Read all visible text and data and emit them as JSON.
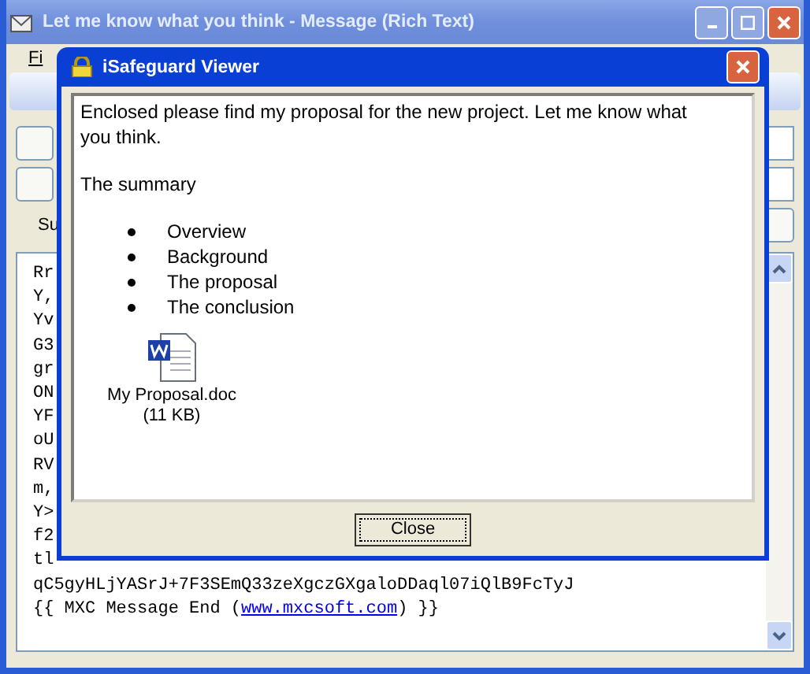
{
  "window": {
    "title": "Let me know what you think - Message (Rich Text)"
  },
  "menu": {
    "item": "Fi"
  },
  "subject_label": "Su",
  "body": {
    "hidden_lines": [
      "Rr",
      "Y,",
      "Yv",
      "G3",
      "gr",
      "ON",
      "YF",
      "oU",
      "RV",
      "m,",
      "Y>",
      "f2",
      "tl"
    ],
    "lines": [
      {
        "text": "qC5gyHLjYASrJ+7F3SEmQ33zeXgczGXgaloDDaql07iQlB9FcTyJ"
      },
      {
        "text": "{{ MXC Message End (",
        "link": "www.mxcsoft.com",
        "after": ") }}"
      }
    ]
  },
  "dialog": {
    "title": "iSafeguard Viewer",
    "paragraphs": [
      "Enclosed please find my proposal for the new project. Let me know what you think.",
      "The summary"
    ],
    "bullets": [
      "Overview",
      "Background",
      "The proposal",
      "The conclusion"
    ],
    "attachment": {
      "name": "My Proposal.doc",
      "size": "(11 KB)"
    },
    "button": "Close"
  }
}
